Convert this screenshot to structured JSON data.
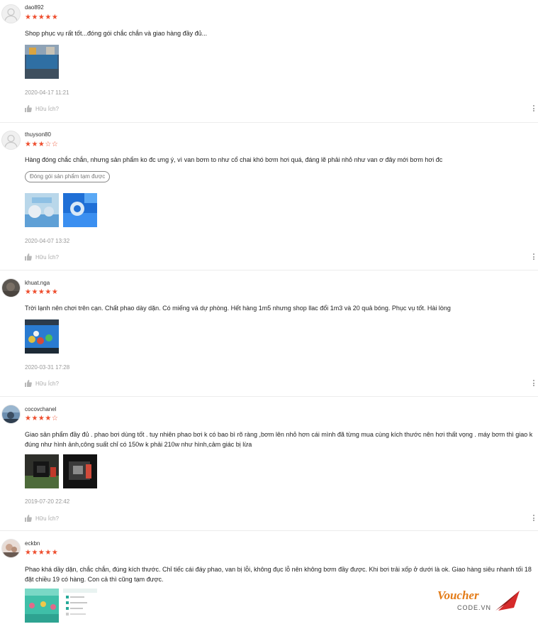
{
  "reviews": [
    {
      "username": "dao892",
      "rating": "★★★★★",
      "rating_value": 5,
      "content": "Shop phục vụ rất tốt...đóng gói chắc chắn và giao hàng đầy đủ...",
      "date": "2020-04-17 11:21",
      "helpful_label": "Hữu Ích?",
      "avatar": "default-user-icon"
    },
    {
      "username": "thuyson80",
      "rating": "★★★☆☆",
      "rating_value": 3,
      "content": "Hàng đóng chắc chắn, nhưng sản phẩm ko đc ưng ý, vì van bơm to như cổ chai khó bơm hơi quá, đáng lẽ phải nhỏ như van ơ đây mới bơm hơi đc",
      "tag": "Đóng gói sản phẩm tạm được",
      "date": "2020-04-07 13:32",
      "helpful_label": "Hữu Ích?",
      "avatar": "default-user-icon"
    },
    {
      "username": "khuat.nga",
      "rating": "★★★★★",
      "rating_value": 5,
      "content": "Trời lạnh nên chơi trên cạn. Chất phao dày dặn. Có miếng vá dự phòng. Hết hàng 1m5 nhưng shop llac đổi 1m3 và 20 quả bóng. Phục vụ tốt. Hài lòng",
      "date": "2020-03-31 17:28",
      "helpful_label": "Hữu Ích?",
      "avatar": "photo-avatar"
    },
    {
      "username": "cocovchanel",
      "rating": "★★★★☆",
      "rating_value": 4,
      "content": "Giao sản phẩm đầy đủ . phao bơi dùng tốt . tuy nhiên phao bơi k có bao bì rõ ràng ,bơm lên nhỏ hơn cái mình đã từng mua cùng kích thước nên hơi thất vọng . máy bơm thì giao k đúng như hình ảnh,công suất chỉ có 150w k phải 210w như hình,cảm giác bị lừa",
      "date": "2019-07-20 22:42",
      "helpful_label": "Hữu Ích?",
      "avatar": "photo-avatar"
    },
    {
      "username": "eckbn",
      "rating": "★★★★★",
      "rating_value": 5,
      "content": "Phao khá dầy dặn, chắc chắn, đúng kích thước. Chỉ tiếc cái đáy phao, van bị lỗi, không đục lỗ nên không bơm đầy được. Khi bơi trải xốp ở dưới là ok. Giao hàng siêu nhanh tối 18 đặt chiều 19 có hàng. Con cả thì cũng tạm được.",
      "avatar": "photo-avatar"
    }
  ],
  "watermark": {
    "line1": "Voucher",
    "line2": "CODE.VN"
  },
  "colors": {
    "star": "#ee4d2d",
    "muted": "#999999"
  }
}
